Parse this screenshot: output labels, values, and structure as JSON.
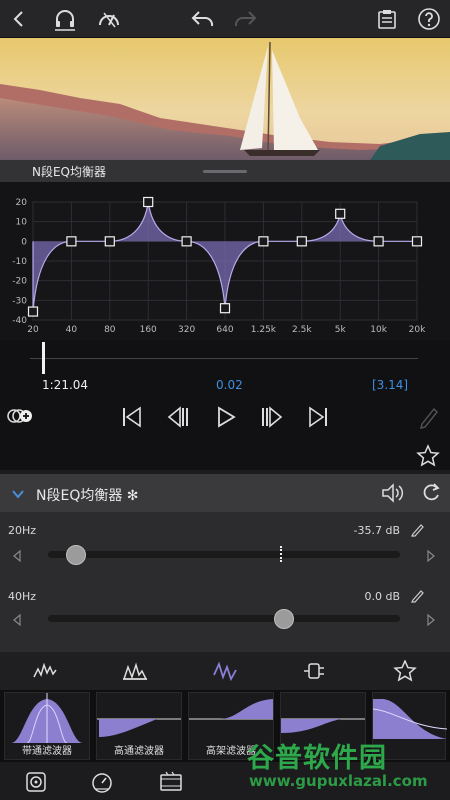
{
  "header": {
    "icons": [
      "back-icon",
      "headphones-icon",
      "gauge-icon",
      "undo-icon",
      "redo-icon",
      "clipboard-icon",
      "help-icon"
    ]
  },
  "eq_panel": {
    "title": "N段EQ均衡器"
  },
  "chart_data": {
    "type": "line",
    "y_ticks": [
      "20",
      "10",
      "0",
      "-10",
      "-20",
      "-30",
      "-40"
    ],
    "x_ticks": [
      "20",
      "40",
      "80",
      "160",
      "320",
      "640",
      "1.25k",
      "2.5k",
      "5k",
      "10k",
      "20k"
    ],
    "ylim": [
      -40,
      20
    ],
    "nodes": [
      {
        "freq": "20",
        "gain": -35.7
      },
      {
        "freq": "40",
        "gain": 0
      },
      {
        "freq": "80",
        "gain": 0
      },
      {
        "freq": "160",
        "gain": 20
      },
      {
        "freq": "320",
        "gain": 0
      },
      {
        "freq": "640",
        "gain": -34
      },
      {
        "freq": "1.25k",
        "gain": 0
      },
      {
        "freq": "2.5k",
        "gain": 0
      },
      {
        "freq": "5k",
        "gain": 14
      },
      {
        "freq": "10k",
        "gain": 0
      },
      {
        "freq": "20k",
        "gain": 0
      }
    ],
    "colors": {
      "fill": "#7a6bb0",
      "line": "#b8a9ea"
    }
  },
  "timeline": {
    "position": "1:21.04",
    "selection": "0.02",
    "duration": "[3.14]",
    "accent": "#3d8fe0"
  },
  "effect": {
    "name": "N段EQ均衡器 ✻",
    "params": [
      {
        "label": "20Hz",
        "value": "-35.7 dB",
        "fraction": 0.08
      },
      {
        "label": "40Hz",
        "value": "0.0 dB",
        "fraction": 0.67
      }
    ]
  },
  "tabs": [
    "waveform-icon",
    "spectrum-icon",
    "eq-filter-icon",
    "plugin-icon",
    "star-icon"
  ],
  "presets": [
    {
      "label": "带通滤波器"
    },
    {
      "label": "高通滤波器"
    },
    {
      "label": "高架滤波器"
    },
    {
      "label": ""
    },
    {
      "label": ""
    }
  ],
  "bottom_icons": [
    "target-icon",
    "speedometer-icon",
    "film-icon"
  ],
  "watermark": {
    "title": "谷普软件园",
    "url": "www.gupuxlazal.com"
  }
}
